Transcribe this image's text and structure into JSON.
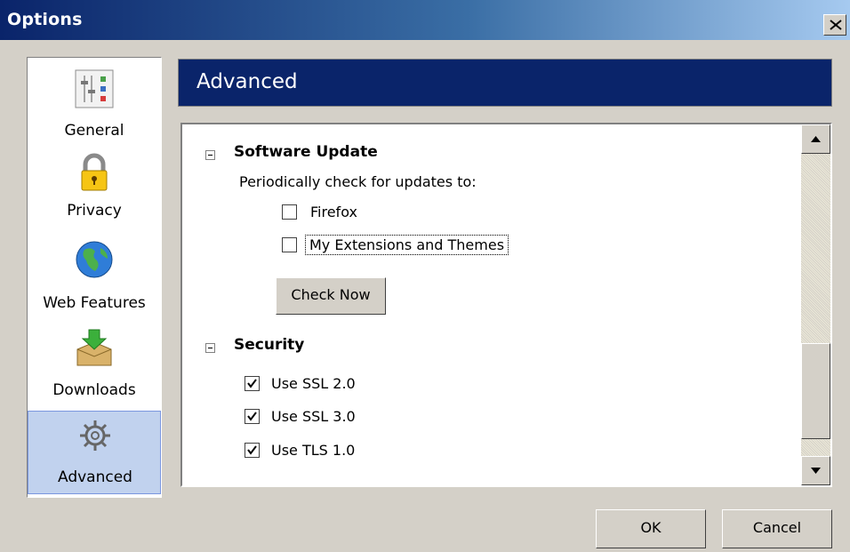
{
  "window": {
    "title": "Options"
  },
  "sidebar": {
    "items": [
      {
        "label": "General",
        "icon": "general-settings-icon"
      },
      {
        "label": "Privacy",
        "icon": "padlock-icon"
      },
      {
        "label": "Web Features",
        "icon": "globe-icon"
      },
      {
        "label": "Downloads",
        "icon": "download-box-icon"
      },
      {
        "label": "Advanced",
        "icon": "gears-icon",
        "selected": true
      }
    ]
  },
  "panel": {
    "title": "Advanced",
    "software_update": {
      "heading": "Software Update",
      "description": "Periodically check for updates to:",
      "options": [
        {
          "label": "Firefox",
          "checked": false
        },
        {
          "label": "My Extensions and Themes",
          "checked": false
        }
      ],
      "check_button": "Check Now"
    },
    "security": {
      "heading": "Security",
      "options": [
        {
          "label": "Use SSL 2.0",
          "checked": true
        },
        {
          "label": "Use SSL 3.0",
          "checked": true
        },
        {
          "label": "Use TLS 1.0",
          "checked": true
        }
      ]
    }
  },
  "buttons": {
    "ok": "OK",
    "cancel": "Cancel"
  },
  "colors": {
    "header": "#0a246a",
    "dialog": "#d4d0c8",
    "selected": "#c1d2ee"
  }
}
